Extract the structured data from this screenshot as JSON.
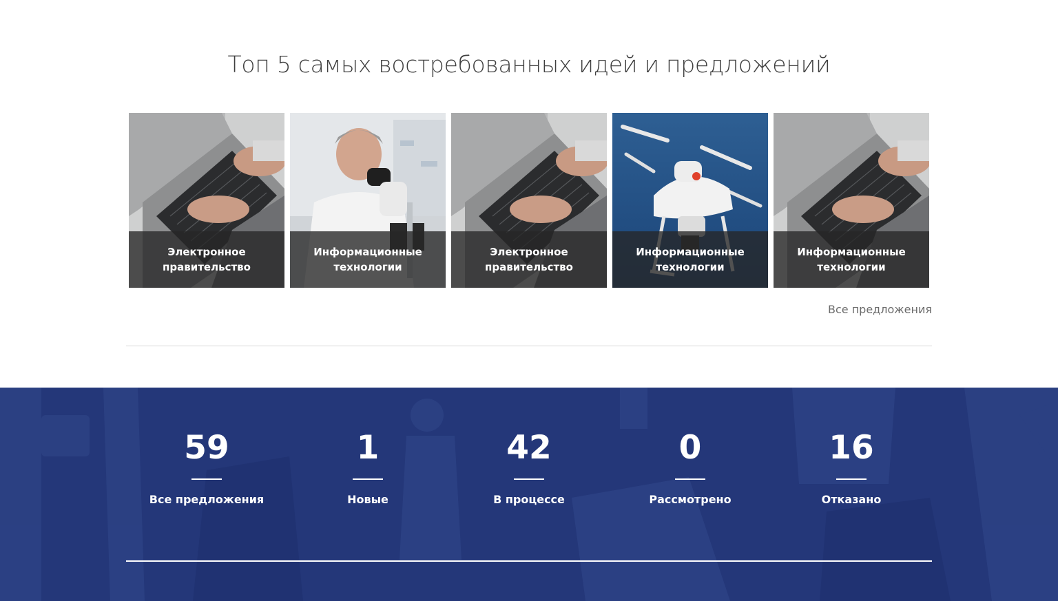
{
  "header": {
    "title": "Топ 5 самых востребованных идей и предложений"
  },
  "cards": [
    {
      "caption": "Электронное\nправительство",
      "image": "laptop-typing"
    },
    {
      "caption": "Информационные\nтехнологии",
      "image": "scientist-microscope"
    },
    {
      "caption": "Электронное\nправительство",
      "image": "laptop-typing"
    },
    {
      "caption": "Информационные\nтехнологии",
      "image": "drone"
    },
    {
      "caption": "Информационные\nтехнологии",
      "image": "laptop-typing"
    }
  ],
  "links": {
    "all_proposals": "Все предложения"
  },
  "stats": [
    {
      "value": "59",
      "label": "Все предложения"
    },
    {
      "value": "1",
      "label": "Новые"
    },
    {
      "value": "42",
      "label": "В процессе"
    },
    {
      "value": "0",
      "label": "Рассмотрено"
    },
    {
      "value": "16",
      "label": "Отказано"
    }
  ],
  "colors": {
    "stats_background": "#243779",
    "caption_overlay": "#262626",
    "title_text": "#3f3f3f"
  }
}
